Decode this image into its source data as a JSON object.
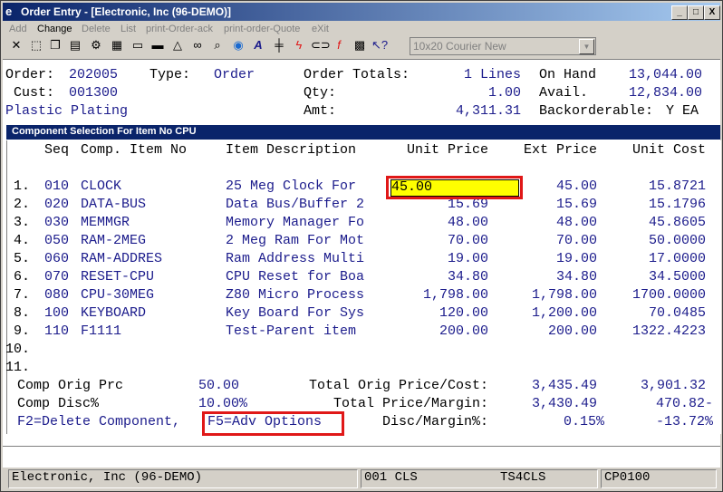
{
  "window": {
    "title": "Order Entry - [Electronic, Inc (96-DEMO)]",
    "app_icon": "e-logo-icon",
    "controls": [
      "_",
      "□",
      "X"
    ]
  },
  "menu": [
    "Add",
    "Change",
    "Delete",
    "List",
    "print-Order-ack",
    "print-order-Quote",
    "eXit"
  ],
  "toolbar": {
    "icons": [
      "close-x-icon",
      "select-icon",
      "copy-icon",
      "paste-icon",
      "settings-icon",
      "browse-icon",
      "note-icon",
      "folder-icon",
      "bell-icon",
      "binoculars-icon",
      "search-icon",
      "globe-icon",
      "font-a-icon",
      "ruler-icon",
      "lightning-icon",
      "link-icon",
      "function-icon",
      "grid-icon",
      "help-pointer-icon"
    ],
    "font_select": "10x20 Courier New"
  },
  "header": {
    "order_label": "Order:",
    "order_value": "202005",
    "type_label": "Type:",
    "type_value": "Order",
    "cust_label": "Cust:",
    "cust_value": "001300",
    "cust_name": "Plastic Plating",
    "order_totals_label": "Order Totals:",
    "lines_value": "1 Lines",
    "qty_label": "Qty:",
    "qty_value": "1.00",
    "amt_label": "Amt:",
    "amt_value": "4,311.31",
    "on_hand_label": "On Hand",
    "on_hand_value": "13,044.00",
    "avail_label": "Avail.",
    "avail_value": "12,834.00",
    "backorderable_label": "Backorderable:",
    "backorderable_value": "Y EA"
  },
  "section_title": "Component Selection For Item No CPU",
  "columns": {
    "seq": "Seq",
    "comp": "Comp. Item No",
    "desc": "Item Description",
    "unit_price": "Unit Price",
    "ext_price": "Ext Price",
    "unit_cost": "Unit Cost"
  },
  "rows": [
    {
      "num": "1.",
      "seq": "010",
      "item": "CLOCK",
      "desc": "25 Meg Clock For",
      "unit": "45.00",
      "ext": "45.00",
      "cost": "15.8721"
    },
    {
      "num": "2.",
      "seq": "020",
      "item": "DATA-BUS",
      "desc": "Data Bus/Buffer 2",
      "unit": "15.69",
      "ext": "15.69",
      "cost": "15.1796"
    },
    {
      "num": "3.",
      "seq": "030",
      "item": "MEMMGR",
      "desc": "Memory Manager Fo",
      "unit": "48.00",
      "ext": "48.00",
      "cost": "45.8605"
    },
    {
      "num": "4.",
      "seq": "050",
      "item": "RAM-2MEG",
      "desc": "2 Meg Ram For Mot",
      "unit": "70.00",
      "ext": "70.00",
      "cost": "50.0000"
    },
    {
      "num": "5.",
      "seq": "060",
      "item": "RAM-ADDRES",
      "desc": "Ram Address Multi",
      "unit": "19.00",
      "ext": "19.00",
      "cost": "17.0000"
    },
    {
      "num": "6.",
      "seq": "070",
      "item": "RESET-CPU",
      "desc": "CPU Reset for Boa",
      "unit": "34.80",
      "ext": "34.80",
      "cost": "34.5000"
    },
    {
      "num": "7.",
      "seq": "080",
      "item": "CPU-30MEG",
      "desc": "Z80 Micro Process",
      "unit": "1,798.00",
      "ext": "1,798.00",
      "cost": "1700.0000"
    },
    {
      "num": "8.",
      "seq": "100",
      "item": "KEYBOARD",
      "desc": "Key Board For Sys",
      "unit": "120.00",
      "ext": "1,200.00",
      "cost": "70.0485"
    },
    {
      "num": "9.",
      "seq": "110",
      "item": "F1111",
      "desc": "Test-Parent item",
      "unit": "200.00",
      "ext": "200.00",
      "cost": "1322.4223"
    },
    {
      "num": "10.",
      "seq": "",
      "item": "",
      "desc": "",
      "unit": "",
      "ext": "",
      "cost": ""
    },
    {
      "num": "11.",
      "seq": "",
      "item": "",
      "desc": "",
      "unit": "",
      "ext": "",
      "cost": ""
    }
  ],
  "edit_value": "45.00",
  "footer": {
    "comp_orig_prc_label": "Comp Orig Prc",
    "comp_orig_prc_value": "50.00",
    "comp_disc_label": "Comp Disc%",
    "comp_disc_value": "10.00%",
    "total_orig_label": "Total Orig Price/Cost:",
    "total_orig_price": "3,435.49",
    "total_orig_cost": "3,901.32",
    "total_price_label": "Total Price/Margin:",
    "total_price": "3,430.49",
    "total_margin": "470.82-",
    "disc_margin_label": "Disc/Margin%:",
    "disc_pct": "0.15%",
    "margin_pct": "-13.72%",
    "f2_hint": "F2=Delete Component,",
    "f5_hint": "F5=Adv Options"
  },
  "status": {
    "company": "Electronic, Inc (96-DEMO)",
    "user": "001 CLS",
    "terminal": "TS4CLS",
    "program": "CP0100"
  },
  "colors": {
    "title_start": "#0a246a",
    "field_blue": "#1c1c8c",
    "edit_yellow": "#ffff00",
    "highlight_red": "#e01818"
  }
}
